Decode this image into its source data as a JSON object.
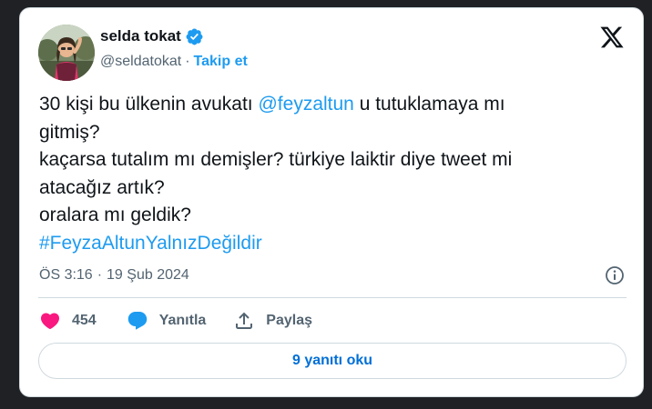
{
  "author": {
    "display_name": "selda tokat",
    "handle": "@seldatokat",
    "separator": "·",
    "follow_label": "Takip et",
    "verified_icon": "verified-badge-icon",
    "avatar": "profile-photo"
  },
  "brand": {
    "logo": "x-logo-icon"
  },
  "tweet": {
    "line1_a": "30 kişi bu ülkenin avukatı ",
    "mention": "@feyzaltun",
    "line1_b": " u tutuklamaya mı",
    "line2": "gitmiş?",
    "line3": "kaçarsa tutalım mı demişler? türkiye laiktir diye tweet mi",
    "line4": "atacağız artık?",
    "line5": "oralara mı geldik?",
    "hashtag": "#FeyzaAltunYalnızDeğildir"
  },
  "meta": {
    "time": "ÖS 3:16",
    "separator": "·",
    "date": "19 Şub 2024",
    "info_icon": "info-icon"
  },
  "actions": {
    "like_count": "454",
    "reply_label": "Yanıtla",
    "share_label": "Paylaş"
  },
  "read_replies_label": "9 yanıtı oku",
  "colors": {
    "accent": "#1d9bf0",
    "like": "#f91880",
    "text": "#0f1419",
    "muted": "#536471",
    "border": "#cfd9de"
  }
}
